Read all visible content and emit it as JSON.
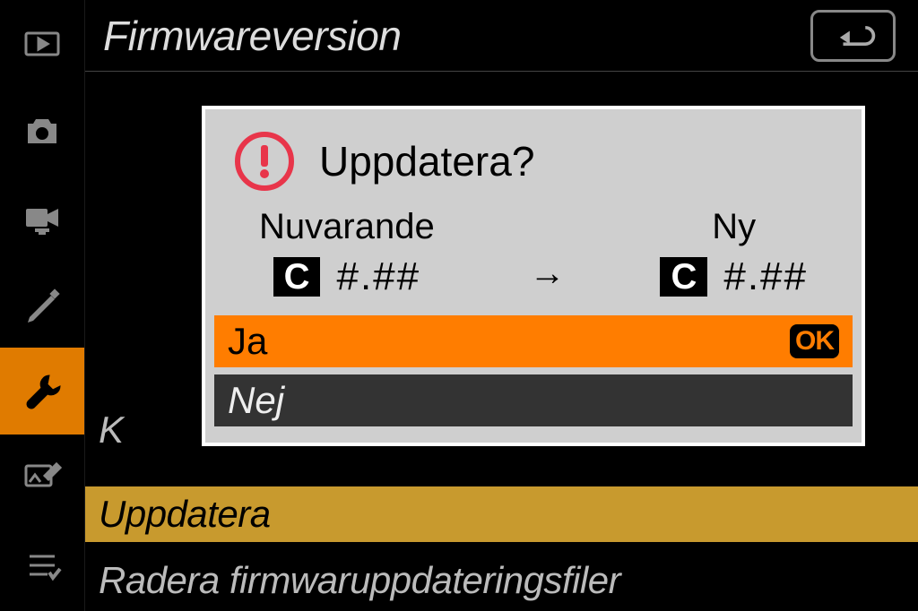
{
  "header": {
    "title": "Firmwareversion"
  },
  "background_rows": {
    "k": "K",
    "update": "Uppdatera",
    "delete": "Radera firmwaruppdateringsfiler"
  },
  "dialog": {
    "title": "Uppdatera?",
    "current_label": "Nuvarande",
    "new_label": "Ny",
    "badge": "C",
    "current_version": "#.##",
    "new_version": "#.##",
    "arrow": "→",
    "options": {
      "yes": "Ja",
      "no": "Nej",
      "ok": "OK"
    }
  },
  "sidebar": {
    "items": [
      "playback",
      "photo",
      "video",
      "pencil",
      "wrench",
      "retouch",
      "mymenu"
    ]
  }
}
